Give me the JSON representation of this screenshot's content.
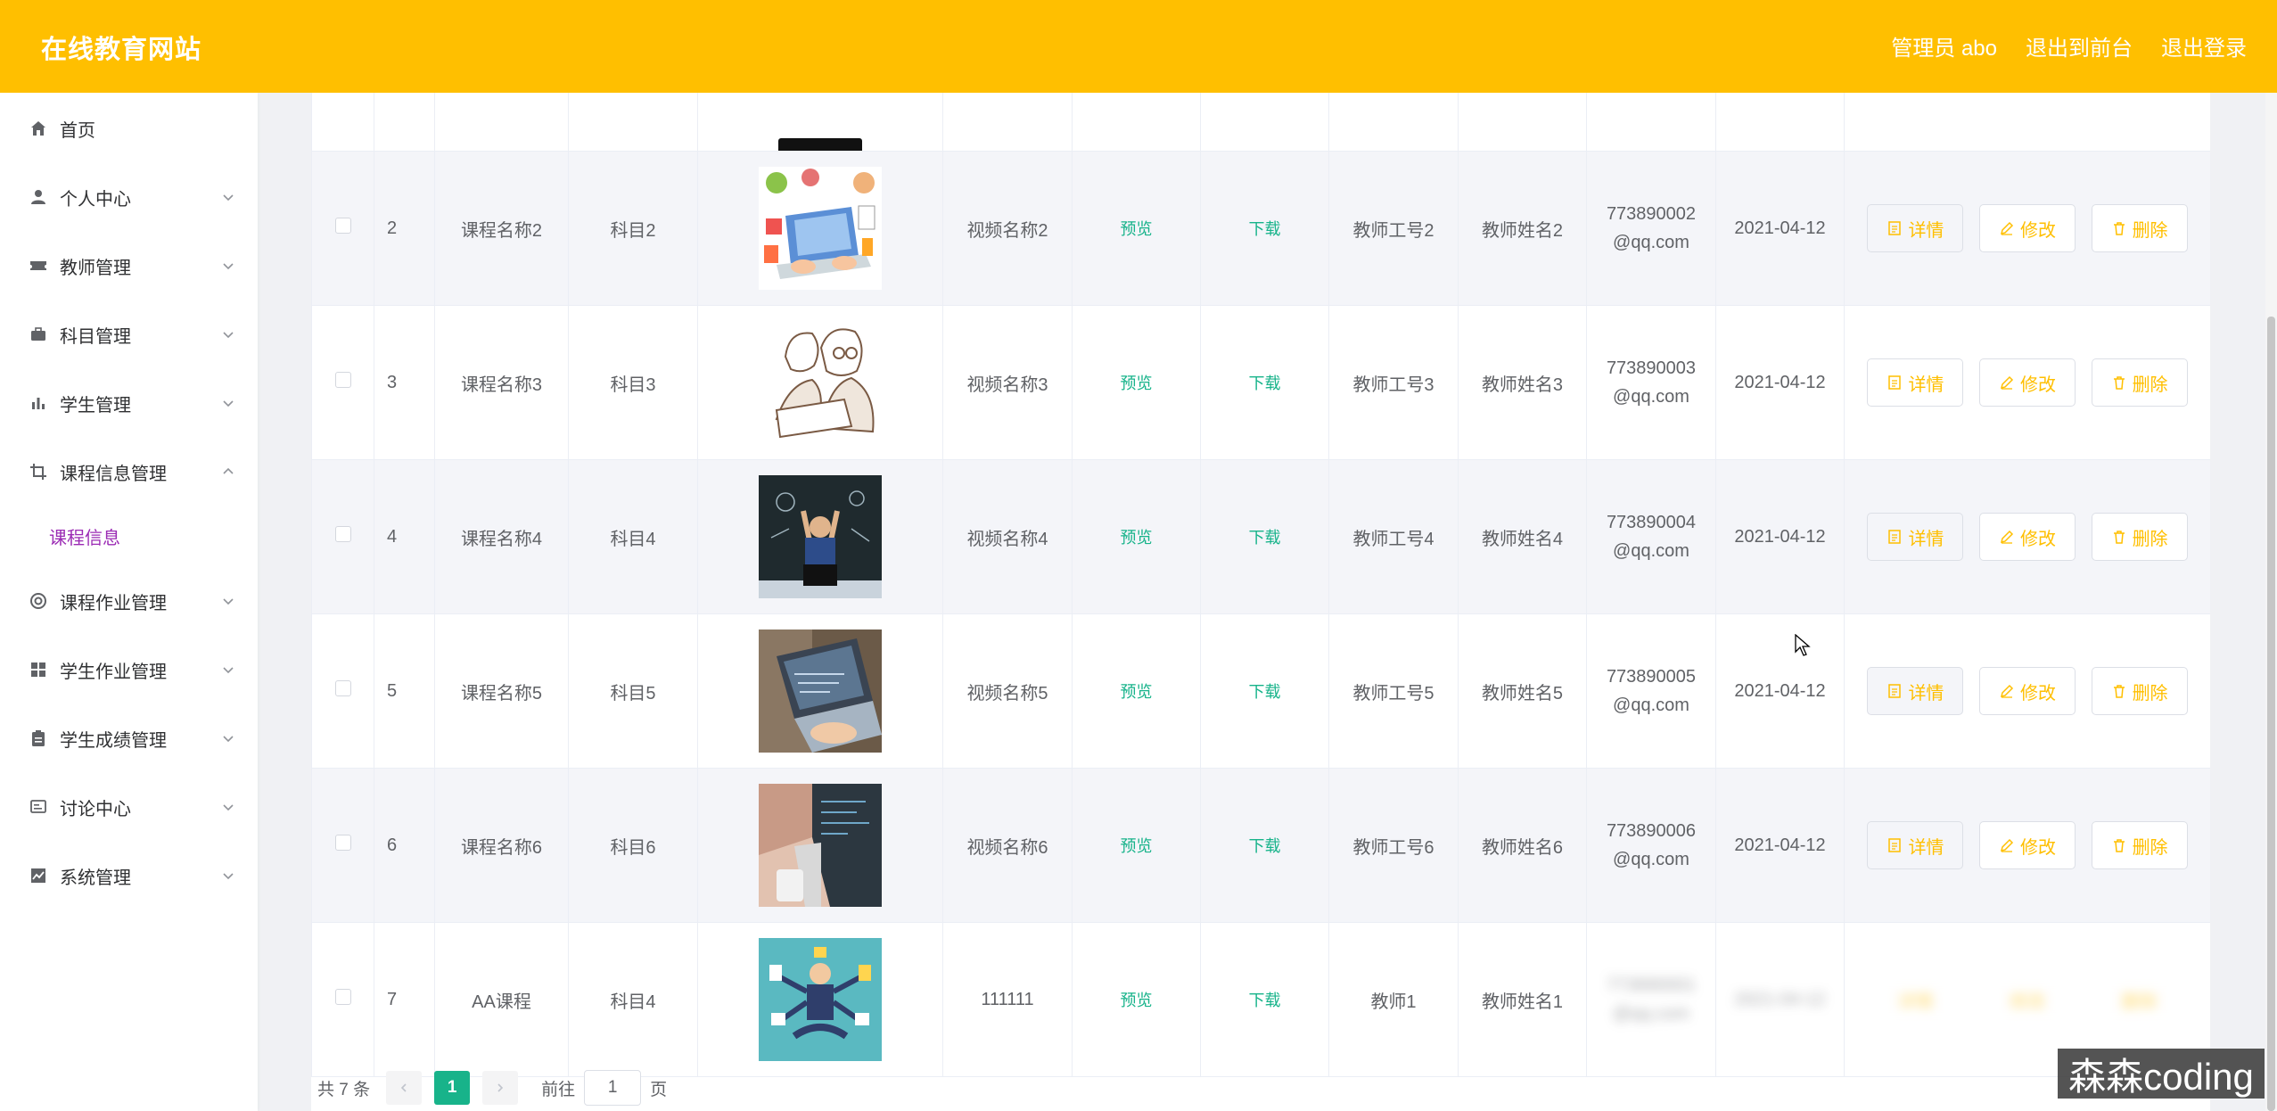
{
  "header": {
    "brand": "在线教育网站",
    "user": "管理员 abo",
    "to_front": "退出到前台",
    "logout": "退出登录"
  },
  "sidebar": {
    "items": [
      {
        "label": "首页",
        "icon": "home-icon"
      },
      {
        "label": "个人中心",
        "icon": "user-icon"
      },
      {
        "label": "教师管理",
        "icon": "ticket-icon"
      },
      {
        "label": "科目管理",
        "icon": "briefcase-icon"
      },
      {
        "label": "学生管理",
        "icon": "bar-chart-icon"
      },
      {
        "label": "课程信息管理",
        "icon": "crop-icon"
      },
      {
        "label": "课程作业管理",
        "icon": "lifebuoy-icon"
      },
      {
        "label": "学生作业管理",
        "icon": "grid-icon"
      },
      {
        "label": "学生成绩管理",
        "icon": "clipboard-icon"
      },
      {
        "label": "讨论中心",
        "icon": "chat-icon"
      },
      {
        "label": "系统管理",
        "icon": "line-chart-icon"
      }
    ],
    "active_sub": "课程信息"
  },
  "table": {
    "preview_label": "预览",
    "download_label": "下载",
    "detail_label": "详情",
    "edit_label": "修改",
    "delete_label": "删除",
    "rows": [
      {
        "no": "2",
        "course": "课程名称2",
        "subject": "科目2",
        "video": "视频名称2",
        "teacher_id": "教师工号2",
        "teacher_name": "教师姓名2",
        "email1": "773890002",
        "email2": "@qq.com",
        "date": "2021-04-12"
      },
      {
        "no": "3",
        "course": "课程名称3",
        "subject": "科目3",
        "video": "视频名称3",
        "teacher_id": "教师工号3",
        "teacher_name": "教师姓名3",
        "email1": "773890003",
        "email2": "@qq.com",
        "date": "2021-04-12"
      },
      {
        "no": "4",
        "course": "课程名称4",
        "subject": "科目4",
        "video": "视频名称4",
        "teacher_id": "教师工号4",
        "teacher_name": "教师姓名4",
        "email1": "773890004",
        "email2": "@qq.com",
        "date": "2021-04-12"
      },
      {
        "no": "5",
        "course": "课程名称5",
        "subject": "科目5",
        "video": "视频名称5",
        "teacher_id": "教师工号5",
        "teacher_name": "教师姓名5",
        "email1": "773890005",
        "email2": "@qq.com",
        "date": "2021-04-12"
      },
      {
        "no": "6",
        "course": "课程名称6",
        "subject": "科目6",
        "video": "视频名称6",
        "teacher_id": "教师工号6",
        "teacher_name": "教师姓名6",
        "email1": "773890006",
        "email2": "@qq.com",
        "date": "2021-04-12"
      },
      {
        "no": "7",
        "course": "AA课程",
        "subject": "科目4",
        "video": "111111",
        "teacher_id": "教师1",
        "teacher_name": "教师姓名1",
        "email1": "773890001",
        "email2": "@qq.com",
        "date": "2021-04-12"
      }
    ]
  },
  "pagination": {
    "total": "共 7 条",
    "page": "1",
    "goto": "前往",
    "goto_value": "1",
    "page_unit": "页"
  },
  "watermark": "森森coding",
  "colors": {
    "accent": "#FFBF00",
    "green": "#17b38a",
    "submenu": "#9b2bb4"
  }
}
